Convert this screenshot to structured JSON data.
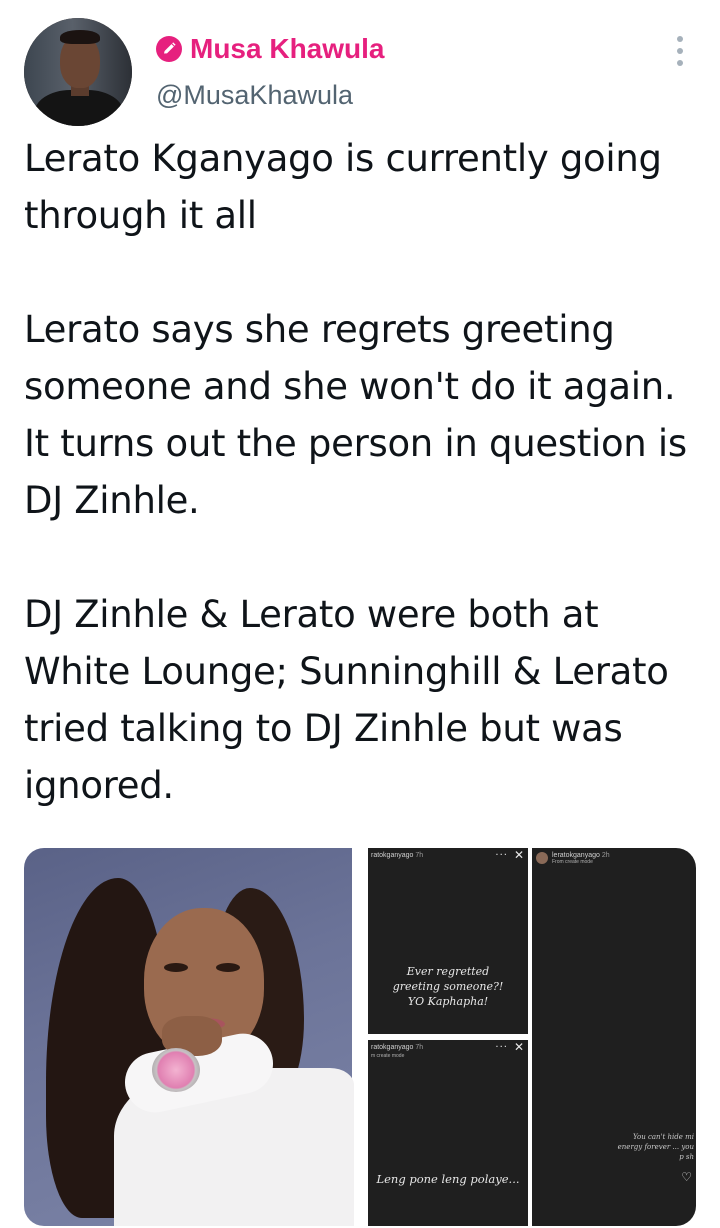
{
  "author": {
    "display_name": "Musa Khawula",
    "handle": "@MusaKhawula",
    "badge_icon": "pencil-icon",
    "name_color": "#e6207e"
  },
  "tweet": {
    "paragraphs": [
      "Lerato Kganyago is currently going through it all",
      "Lerato says she regrets greeting someone and she won't do it again. It turns out the person in question is DJ Zinhle.",
      "DJ Zinhle & Lerato were both at White Lounge; Sunninghill & Lerato tried talking to DJ Zinhle but was ignored."
    ]
  },
  "media": {
    "stories": [
      {
        "username": "ratokganyago",
        "time": "7h",
        "caption": "Ever regretted greeting someone?! YO Kaphapha!"
      },
      {
        "username": "ratokganyago",
        "time": "7h",
        "subtitle": "m create mode",
        "caption": "Leng pone leng polaye..."
      },
      {
        "username": "leratokganyago",
        "time": "2h",
        "subtitle": "From create mode",
        "caption": "You can't hide mi energy forever ... you p sh"
      }
    ]
  }
}
